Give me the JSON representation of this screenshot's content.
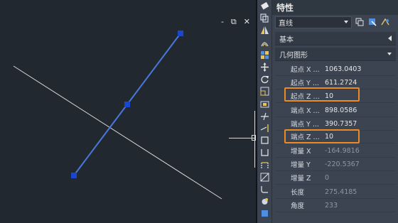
{
  "viewport": {
    "controls": [
      "-",
      "⧉",
      "✕"
    ]
  },
  "drawing": {
    "colors": {
      "selected_line": "#4a78d8",
      "grip": "#1947d0",
      "other_line": "#d8d8d8"
    }
  },
  "toolbar": {
    "icons": [
      "eraser-icon",
      "copy-icon",
      "mirror-icon",
      "offset-icon",
      "array-icon",
      "move-icon",
      "rotate-icon",
      "scale-icon",
      "stretch-icon",
      "trim-icon",
      "extend-icon",
      "break-icon",
      "break-at-point-icon",
      "join-icon",
      "chamfer-icon",
      "fillet-icon",
      "blend-icon",
      "explode-icon"
    ]
  },
  "properties": {
    "title": "特性",
    "object_type": "直线",
    "sections": {
      "basic": "基本",
      "geometry": "几何图形"
    },
    "rows": [
      {
        "name": "起点 X ...",
        "value": "1063.0403",
        "editable": true
      },
      {
        "name": "起点 Y ...",
        "value": "611.2724",
        "editable": true
      },
      {
        "name": "起点 Z ...",
        "value": "10",
        "editable": true
      },
      {
        "name": "端点 X ...",
        "value": "898.0586",
        "editable": true
      },
      {
        "name": "端点 Y ...",
        "value": "390.7357",
        "editable": true
      },
      {
        "name": "端点 Z ...",
        "value": "10",
        "editable": true
      },
      {
        "name": "增量 X",
        "value": "-164.9816",
        "editable": false
      },
      {
        "name": "增量 Y",
        "value": "-220.5367",
        "editable": false
      },
      {
        "name": "增量 Z",
        "value": "0",
        "editable": false
      },
      {
        "name": "长度",
        "value": "275.4185",
        "editable": false
      },
      {
        "name": "角度",
        "value": "233",
        "editable": false
      }
    ],
    "highlight_color": "#ec8a23"
  }
}
